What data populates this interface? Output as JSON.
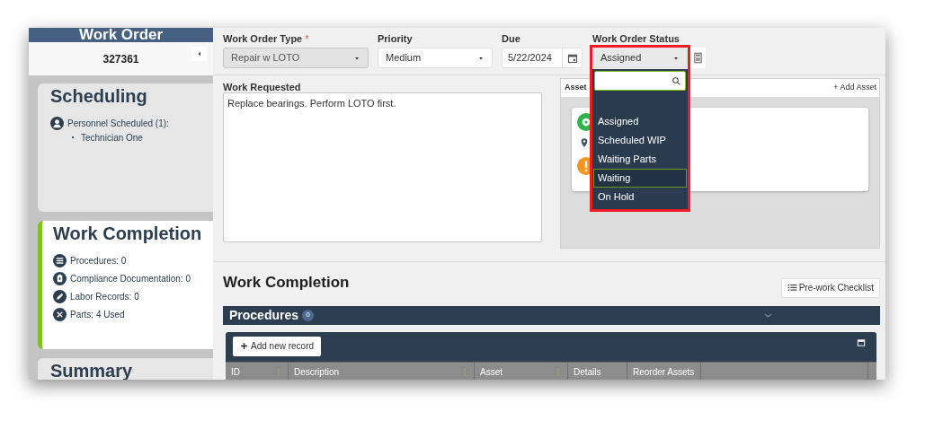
{
  "sidebar": {
    "title": "Work Order",
    "number": "327361",
    "cards": [
      {
        "title": "Scheduling",
        "selected": false,
        "lines": [
          {
            "kind": "personnel",
            "text": "Personnel Scheduled (1):",
            "children": [
              {
                "text": "Technician One"
              }
            ]
          }
        ]
      },
      {
        "title": "Work Completion",
        "selected": true,
        "lines": [
          {
            "kind": "procedures",
            "text": "Procedures: 0"
          },
          {
            "kind": "compliance",
            "text": "Compliance Documentation: 0"
          },
          {
            "kind": "labor",
            "text": "Labor Records: 0"
          },
          {
            "kind": "parts",
            "text": "Parts: 4 Used"
          }
        ]
      },
      {
        "title": "Summary",
        "selected": false
      }
    ]
  },
  "form": {
    "fields": [
      {
        "label": "Work Order Type",
        "required_mark": "*",
        "kind": "select",
        "value": "Repair w LOTO",
        "disabled": true
      },
      {
        "label": "Priority",
        "kind": "select",
        "value": "Medium",
        "disabled": false
      },
      {
        "label": "Due",
        "kind": "date",
        "value": "5/22/2024"
      },
      {
        "label": "Work Order Status",
        "kind": "select",
        "value": "Assigned",
        "disabled": false,
        "open": true,
        "highlight_box": true
      }
    ],
    "status_options": [
      {
        "label": "Assigned",
        "highlighted": false
      },
      {
        "label": "Scheduled WIP",
        "highlighted": false
      },
      {
        "label": "Waiting Parts",
        "highlighted": false
      },
      {
        "label": "Waiting",
        "highlighted": true
      },
      {
        "label": "On Hold",
        "highlighted": false
      }
    ]
  },
  "work_requested": {
    "label": "Work Requested",
    "value": "Replace bearings.  Perform LOTO first."
  },
  "assets": {
    "title": "Asset",
    "add_button": "+ Add Asset"
  },
  "work_completion": {
    "title": "Work Completion",
    "checklist_button": "Pre-work Checklist",
    "procedures": {
      "title": "Procedures",
      "count": "0",
      "expanded": true
    },
    "add_button": "Add new record",
    "columns": [
      {
        "label": "ID",
        "resizable": true
      },
      {
        "label": "Description",
        "resizable": true
      },
      {
        "label": "Asset",
        "resizable": true
      },
      {
        "label": "Details",
        "resizable": false
      },
      {
        "label": "Reorder Assets",
        "resizable": false
      }
    ]
  }
}
